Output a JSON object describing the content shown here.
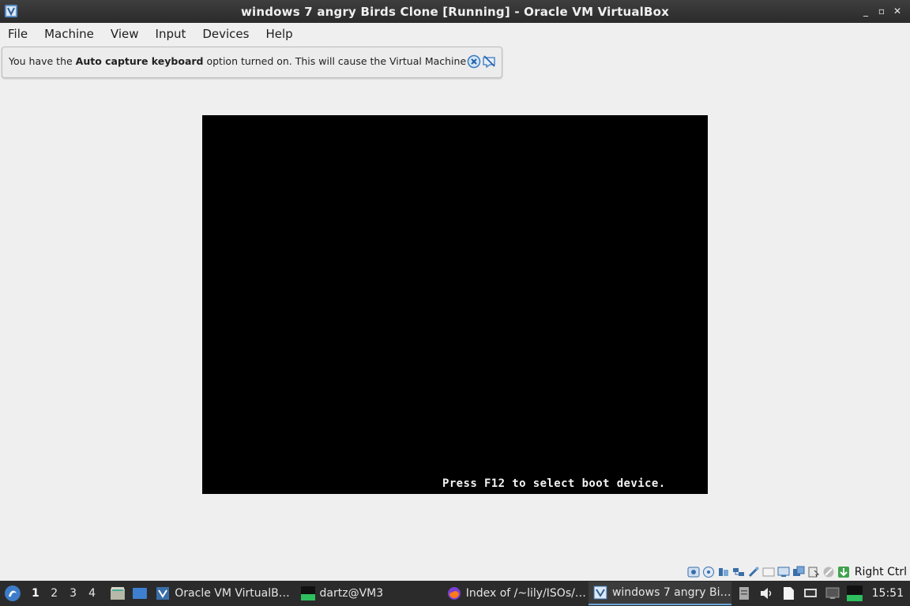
{
  "window": {
    "title": "windows 7 angry Birds Clone [Running] - Oracle VM VirtualBox",
    "controls": {
      "minimize": "_",
      "maximize": "▫",
      "close": "✕"
    }
  },
  "menubar": {
    "items": [
      "File",
      "Machine",
      "View",
      "Input",
      "Devices",
      "Help"
    ]
  },
  "notification": {
    "prefix": "You have the ",
    "bold": "Auto capture keyboard",
    "suffix": " option turned on. This will cause the Virtual Machine to"
  },
  "vm": {
    "boot_message": "Press F12 to select boot device."
  },
  "statusbar": {
    "host_key": "Right Ctrl",
    "icons": [
      "hard-disk-icon",
      "optical-drive-icon",
      "audio-icon",
      "network-icon",
      "usb-icon",
      "shared-folders-icon",
      "display-icon",
      "video-capture-icon",
      "mouse-integration-icon",
      "keyboard-icon"
    ]
  },
  "taskbar": {
    "workspaces": [
      "1",
      "2",
      "3",
      "4"
    ],
    "tasks": [
      {
        "label": "Oracle VM VirtualB…",
        "icon": "virtualbox-icon"
      },
      {
        "label": "dartz@VM3",
        "icon": "terminal-icon"
      },
      {
        "label": "Index of /~lily/ISOs/…",
        "icon": "firefox-icon"
      },
      {
        "label": "windows 7 angry Bi…",
        "icon": "virtualbox-vm-icon"
      }
    ],
    "clock": "15:51"
  },
  "colors": {
    "titlebar": "#2b2b2b",
    "window_bg": "#efefef",
    "vm_screen": "#000000",
    "taskbar": "#2b2b2b"
  }
}
